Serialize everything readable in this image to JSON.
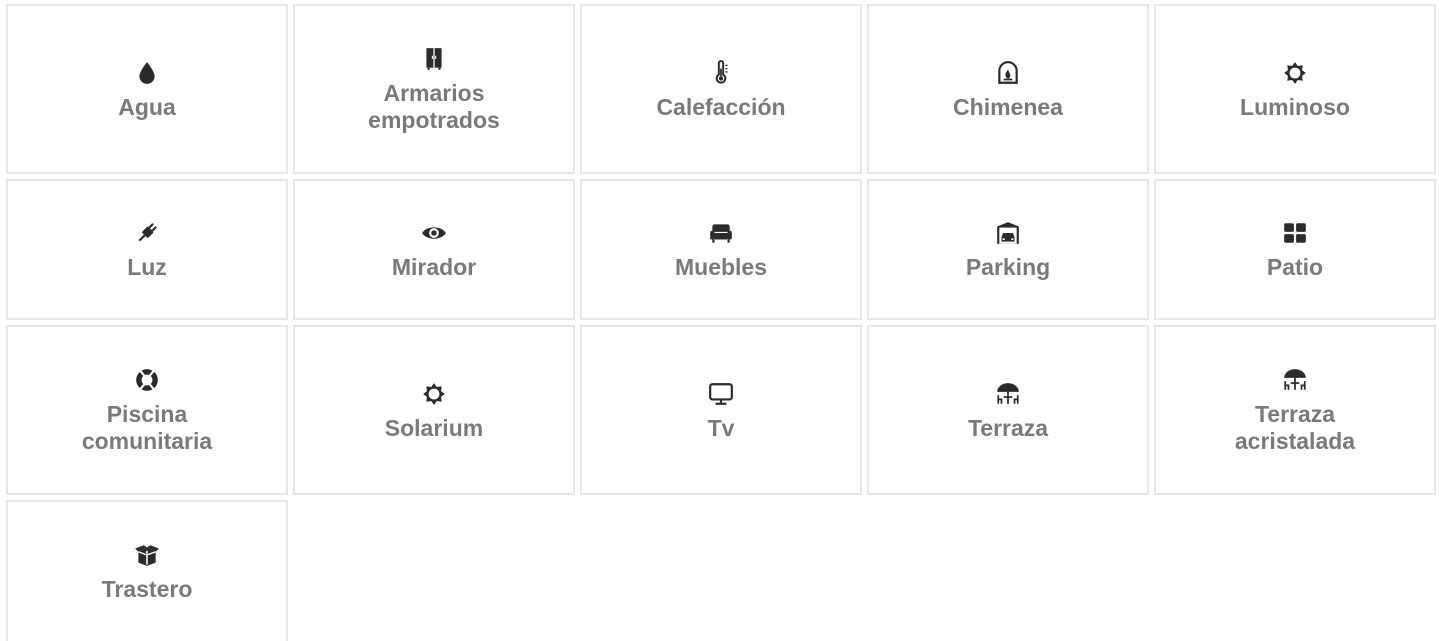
{
  "amenities": [
    {
      "label": "Agua",
      "icon": "water-drop-icon"
    },
    {
      "label": "Armarios empotrados",
      "icon": "wardrobe-icon"
    },
    {
      "label": "Calefacción",
      "icon": "thermometer-icon"
    },
    {
      "label": "Chimenea",
      "icon": "fireplace-icon"
    },
    {
      "label": "Luminoso",
      "icon": "sun-icon"
    },
    {
      "label": "Luz",
      "icon": "plug-icon"
    },
    {
      "label": "Mirador",
      "icon": "eye-icon"
    },
    {
      "label": "Muebles",
      "icon": "armchair-icon"
    },
    {
      "label": "Parking",
      "icon": "garage-icon"
    },
    {
      "label": "Patio",
      "icon": "grid-squares-icon"
    },
    {
      "label": "Piscina comunitaria",
      "icon": "life-ring-icon"
    },
    {
      "label": "Solarium",
      "icon": "sun-icon"
    },
    {
      "label": "Tv",
      "icon": "monitor-icon"
    },
    {
      "label": "Terraza",
      "icon": "patio-umbrella-icon"
    },
    {
      "label": "Terraza acristalada",
      "icon": "patio-umbrella-icon"
    },
    {
      "label": "Trastero",
      "icon": "storage-box-icon"
    }
  ],
  "colors": {
    "label": "#7a7a7a",
    "icon": "#2b2b2b",
    "border": "#e7e7e7"
  }
}
